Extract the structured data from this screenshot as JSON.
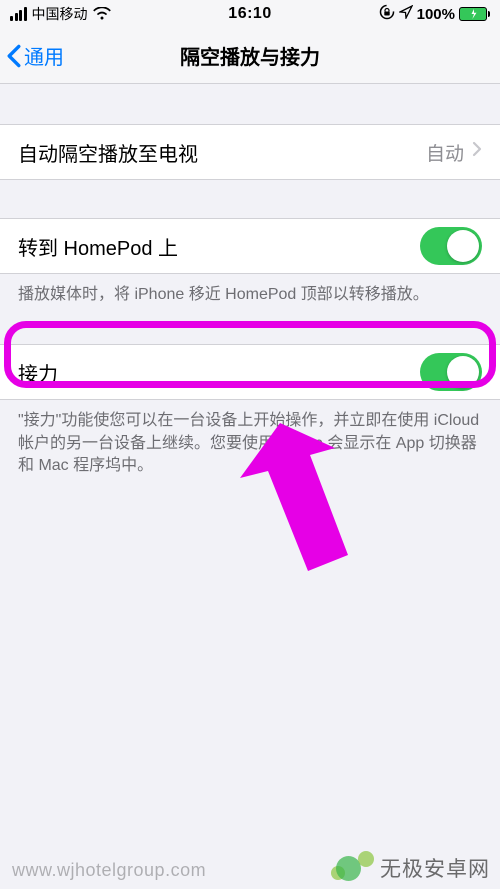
{
  "status_bar": {
    "carrier": "中国移动",
    "time": "16:10",
    "battery_percent": "100%"
  },
  "nav": {
    "back_label": "通用",
    "title": "隔空播放与接力"
  },
  "rows": {
    "airplay_tv": {
      "label": "自动隔空播放至电视",
      "value": "自动"
    },
    "homepod": {
      "label": "转到 HomePod 上"
    },
    "homepod_footer": "播放媒体时，将 iPhone 移近 HomePod 顶部以转移播放。",
    "handoff": {
      "label": "接力"
    },
    "handoff_footer": "\"接力\"功能使您可以在一台设备上开始操作，并立即在使用 iCloud 帐户的另一台设备上继续。您要使用的 App 会显示在 App 切换器和 Mac 程序坞中。"
  },
  "watermarks": {
    "url": "www.wjhotelgroup.com",
    "brand": "无极安卓网"
  }
}
